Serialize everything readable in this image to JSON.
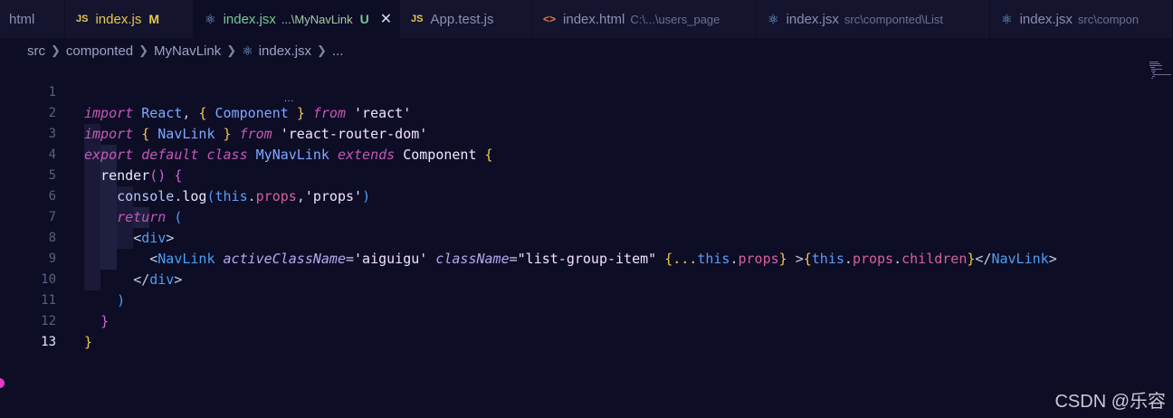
{
  "tabs": [
    {
      "icon": "",
      "name": "html",
      "desc": "",
      "badge": "",
      "badge_color": ""
    },
    {
      "icon": "JS",
      "name": "index.js",
      "desc": "",
      "badge": "M",
      "badge_color": "#e6c84a",
      "name_color": "#e6c84a"
    },
    {
      "icon": "react",
      "name": "index.jsx",
      "desc": "...\\MyNavLink",
      "badge": "U",
      "badge_color": "#73c991",
      "name_color": "#73c991",
      "active": true,
      "close": "✕"
    },
    {
      "icon": "JS",
      "name": "App.test.js",
      "desc": "",
      "badge": "",
      "badge_color": ""
    },
    {
      "icon": "html",
      "name": "index.html",
      "desc": "C:\\...\\users_page",
      "badge": "",
      "badge_color": ""
    },
    {
      "icon": "react",
      "name": "index.jsx",
      "desc": "src\\componted\\List",
      "badge": "",
      "badge_color": ""
    },
    {
      "icon": "react",
      "name": "index.jsx",
      "desc": "src\\compon",
      "badge": "",
      "badge_color": ""
    }
  ],
  "breadcrumb": {
    "items": [
      "src",
      "componted",
      "MyNavLink",
      "index.jsx",
      "..."
    ]
  },
  "lines": [
    {
      "n": "1"
    },
    {
      "n": "2"
    },
    {
      "n": "3"
    },
    {
      "n": "4"
    },
    {
      "n": "5"
    },
    {
      "n": "6"
    },
    {
      "n": "7"
    },
    {
      "n": "8"
    },
    {
      "n": "9"
    },
    {
      "n": "10"
    },
    {
      "n": "11"
    },
    {
      "n": "12"
    },
    {
      "n": "13",
      "current": true
    }
  ],
  "code": {
    "l1": {
      "import": "import",
      "react": "React",
      "comma": ",",
      "lb": "{",
      "component": "Component",
      "rb": "}",
      "from": "from",
      "src": "'react'"
    },
    "l2": {
      "import": "import",
      "lb": "{",
      "navlink": "NavLink",
      "rb": "}",
      "from": "from",
      "src": "'react-router-dom'"
    },
    "l3": {
      "export": "export",
      "default": "default",
      "class": "class",
      "name": "MyNavLink",
      "extends": "extends",
      "base": "Component",
      "lb": "{"
    },
    "l4": {
      "render": "render",
      "parens": "()",
      "lb": "{"
    },
    "l5": {
      "console": "console",
      "dot": ".",
      "log": "log",
      "lp": "(",
      "this": "this",
      "dot2": ".",
      "props": "props",
      "comma": ",",
      "str": "'props'",
      "rp": ")"
    },
    "l6": {
      "return": "return",
      "lp": "("
    },
    "l7": {
      "lt": "<",
      "tag": "div",
      "gt": ">"
    },
    "l8": {
      "lt": "<",
      "tag": "NavLink",
      "attr1": "activeClassName",
      "eq1": "=",
      "val1": "'aiguigu'",
      "attr2": "className",
      "eq2": "=",
      "val2": "\"list-group-item\"",
      "lb": "{",
      "spread": "...",
      "this": "this",
      "dot": ".",
      "props": "props",
      "rb": "}",
      "gt": ">",
      "lb2": "{",
      "this2": "this",
      "dot2": ".",
      "props2": "props",
      "dot3": ".",
      "children": "children",
      "rb2": "}",
      "close_lt": "</",
      "close_tag": "NavLink",
      "close_gt": ">"
    },
    "l9": {
      "lt": "</",
      "tag": "div",
      "gt": ">"
    },
    "l10": {
      "rp": ")"
    },
    "l11": {
      "rb": "}"
    },
    "l12": {
      "rb": "}"
    }
  },
  "hover_hint": "...",
  "watermark": "CSDN @乐容"
}
